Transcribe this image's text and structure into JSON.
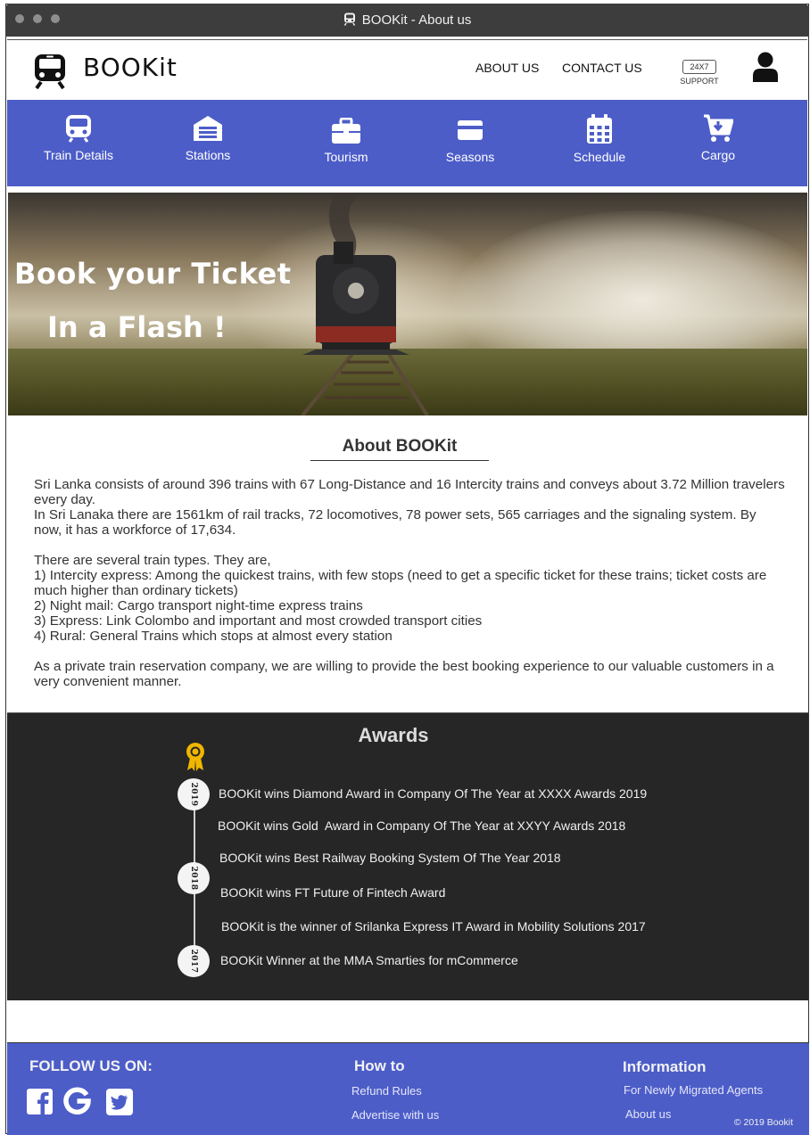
{
  "window": {
    "title": "BOOKit - About us"
  },
  "header": {
    "logo_text": "BOOKit",
    "links": [
      "ABOUT US",
      "CONTACT US"
    ],
    "support_badge": "24X7",
    "support_label": "SUPPORT"
  },
  "nav": {
    "items": [
      {
        "label": "Train Details",
        "icon": "train-icon"
      },
      {
        "label": "Stations",
        "icon": "station-icon"
      },
      {
        "label": "Tourism",
        "icon": "briefcase-icon"
      },
      {
        "label": "Seasons",
        "icon": "card-icon"
      },
      {
        "label": "Schedule",
        "icon": "calendar-icon"
      },
      {
        "label": "Cargo",
        "icon": "cart-icon"
      }
    ]
  },
  "hero": {
    "title": "Book your Ticket",
    "subtitle": "In a Flash !"
  },
  "about": {
    "heading": "About BOOKit",
    "paragraphs": [
      "Sri Lanka consists of around 396 trains with 67 Long-Distance and 16 Intercity trains and conveys about 3.72 Million travelers every day.",
      "In Sri Lanaka there are 1561km of rail tracks, 72 locomotives, 78 power sets, 565 carriages and the signaling system.   By now, it has a workforce of 17,634.",
      "There are several train types. They are,",
      "1) Intercity express: Among the quickest trains, with few stops (need to get a specific ticket for these trains; ticket costs are much higher than ordinary tickets)",
      "2) Night mail: Cargo transport night-time express trains",
      "3) Express: Link Colombo and important and most crowded transport cities",
      "4) Rural: General Trains which stops at almost every station",
      "As a private train reservation company, we are willing to provide the best booking experience to our valuable customers in a very convenient manner."
    ]
  },
  "awards": {
    "heading": "Awards",
    "years": [
      "2019",
      "2018",
      "2017"
    ],
    "items": [
      "BOOKit wins Diamond Award in Company Of The Year at XXXX Awards 2019",
      "BOOKit wins Gold  Award in Company Of The Year at XXYY Awards 2018",
      "BOOKit wins Best Railway Booking System Of The Year 2018",
      "BOOKit wins FT Future of Fintech Award",
      "BOOKit is the winner of Srilanka Express IT Award in Mobility Solutions 2017",
      "BOOKit Winner at the MMA Smarties for mCommerce"
    ]
  },
  "footer": {
    "follow_heading": "FOLLOW US ON:",
    "social_icons": [
      "facebook-icon",
      "google-icon",
      "twitter-icon"
    ],
    "howto_heading": "How to",
    "howto_links": [
      "Refund Rules",
      "Advertise with us"
    ],
    "info_heading": "Information",
    "info_links": [
      "For Newly Migrated Agents",
      "About us"
    ],
    "copyright": "© 2019 Bookit"
  },
  "colors": {
    "nav_blue": "#4c5dc8",
    "awards_bg": "#262626",
    "medal_gold": "#f1b600"
  }
}
